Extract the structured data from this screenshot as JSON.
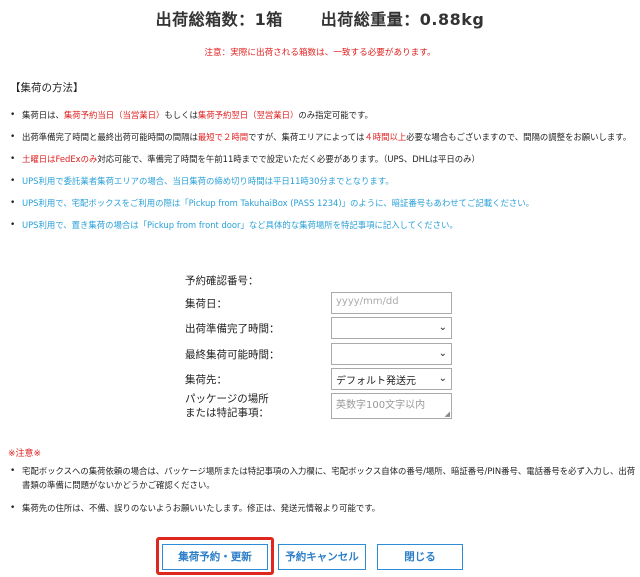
{
  "summary": {
    "box_count": "出荷総箱数：1箱",
    "total_weight": "出荷総重量：0.88kg"
  },
  "notice": "注意：実際に出荷される箱数は、一致する必要があります。",
  "method": {
    "title": "【集荷の方法】",
    "rules": [
      {
        "p1": "集荷日は、",
        "r1": "集荷予約当日（当営業日）",
        "p2": "もしくは",
        "r2": "集荷予約翌日（翌営業日）",
        "p3": "のみ指定可能です。"
      },
      {
        "p1": "出荷準備完了時間と最終出荷可能時間の間隔は",
        "r1": "最短で２時間",
        "p2": "ですが、集荷エリアによっては",
        "r2": "４時間以上",
        "p3": "必要な場合もございますので、間隔の調整をお願いします。"
      },
      {
        "r1": "土曜日はFedExのみ",
        "p1": "対応可能で、準備完了時間を午前11時までで設定いただく必要があります。（UPS、DHLは平日のみ）"
      },
      {
        "text": "UPS利用で委託業者集荷エリアの場合、当日集荷の締め切り時間は平日11時30分までとなります。"
      },
      {
        "text": "UPS利用で、宅配ボックスをご利用の際は「Pickup from TakuhaiBox (PASS 1234)」のように、暗証番号もあわせてご記載ください。"
      },
      {
        "text": "UPS利用で、置き集荷の場合は「Pickup from front door」など具体的な集荷場所を特記事項に記入してください。"
      }
    ]
  },
  "form": {
    "confirmation_label": "予約確認番号：",
    "pickup_date_label": "集荷日：",
    "pickup_date_placeholder": "yyyy/mm/dd",
    "ready_time_label": "出荷準備完了時間：",
    "last_time_label": "最終集荷可能時間：",
    "destination_label": "集荷先：",
    "destination_value": "デフォルト発送元",
    "package_label_line1": "パッケージの場所",
    "package_label_line2": "または特記事項：",
    "package_placeholder": "英数字100文字以内"
  },
  "notes": {
    "title": "※注意※",
    "items": [
      "宅配ボックスへの集荷依頼の場合は、パッケージ場所または特記事項の入力欄に、宅配ボックス自体の番号/場所、暗証番号/PIN番号、電話番号を必ず入力し、出荷書類の準備に問題がないかどうかご確認ください。",
      "集荷先の住所は、不備、誤りのないようお願いいたします。修正は、発送元情報より可能です。"
    ]
  },
  "buttons": {
    "reserve_update": "集荷予約・更新",
    "cancel_reservation": "予約キャンセル",
    "close": "閉じる"
  },
  "colors": {
    "alert_red": "#e02020",
    "info_blue": "#2aa0d8",
    "button_blue": "#2e8bd6",
    "highlight_red": "#e0271f"
  }
}
